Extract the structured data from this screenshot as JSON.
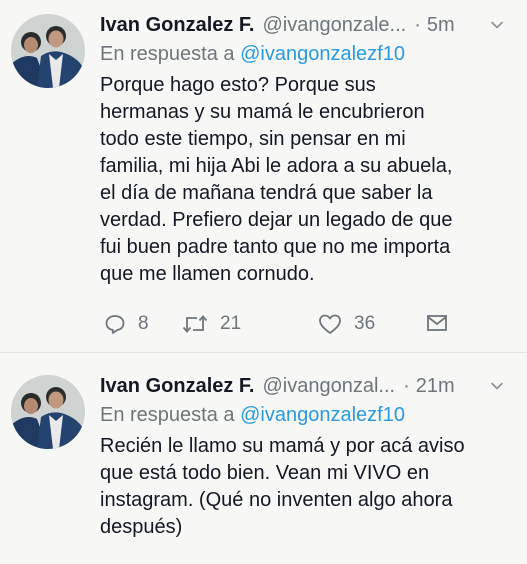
{
  "tweets": [
    {
      "name": "Ivan Gonzalez F.",
      "handle": "@ivangonzale...",
      "separator": "·",
      "time": "5m",
      "reply_prefix": "En respuesta a",
      "reply_mention": "@ivangonzalezf10",
      "text_lines": [
        "Porque hago esto? Porque sus",
        "hermanas y su mamá le encubrieron",
        "todo este tiempo, sin pensar en mi",
        "familia, mi hija Abi le adora a su abuela,",
        "el día de mañana tendrá que saber la",
        "verdad. Prefiero dejar un legado de que",
        "fui buen padre tanto que no me importa",
        "que me llamen cornudo."
      ],
      "replies": "8",
      "retweets": "21",
      "likes": "36"
    },
    {
      "name": "Ivan Gonzalez F.",
      "handle": "@ivangonzal...",
      "separator": "·",
      "time": "21m",
      "reply_prefix": "En respuesta a",
      "reply_mention": "@ivangonzalezf10",
      "text_lines": [
        "Recién le llamo su mamá y por acá aviso",
        "que está todo bien. Vean mi VIVO en",
        "instagram. (Qué no inventen algo ahora",
        "después)"
      ]
    }
  ],
  "icons": {
    "reply": "reply-icon",
    "retweet": "retweet-icon",
    "like": "heart-icon",
    "dm": "envelope-icon",
    "menu": "chevron-down-icon"
  },
  "colors": {
    "link": "#2a9ae0",
    "muted": "#6e767b",
    "text": "#141823",
    "background": "#f7f8f6"
  }
}
